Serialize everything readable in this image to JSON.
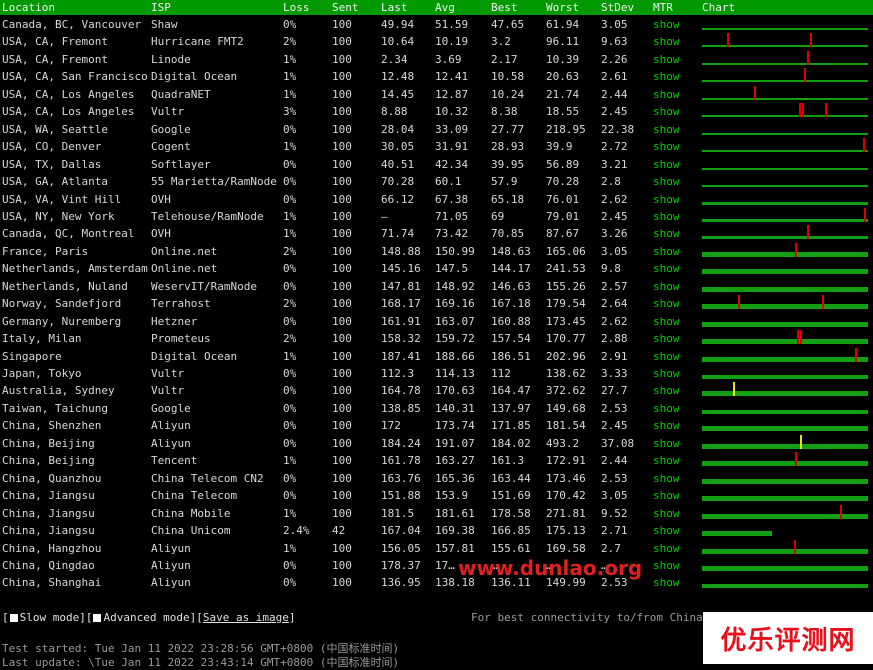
{
  "header": {
    "location": "Location",
    "isp": "ISP",
    "loss": "Loss",
    "sent": "Sent",
    "last": "Last",
    "avg": "Avg",
    "best": "Best",
    "worst": "Worst",
    "stdev": "StDev",
    "mtr": "MTR",
    "chart": "Chart"
  },
  "rows": [
    {
      "location": "Canada, BC, Vancouver",
      "isp": "Shaw",
      "loss": "0%",
      "sent": "100",
      "last": "49.94",
      "avg": "51.59",
      "best": "47.65",
      "worst": "61.94",
      "stdev": "3.05",
      "mtr": "show",
      "chart": {
        "fill": 0.25,
        "spikes": []
      }
    },
    {
      "location": "USA, CA, Fremont",
      "isp": "Hurricane FMT2",
      "loss": "2%",
      "sent": "100",
      "last": "10.64",
      "avg": "10.19",
      "best": "3.2",
      "worst": "96.11",
      "stdev": "9.63",
      "mtr": "show",
      "chart": {
        "fill": 0.25,
        "spikes": [
          {
            "pos": 0.15,
            "h": 0.9,
            "c": "red"
          },
          {
            "pos": 0.66,
            "h": 0.9,
            "c": "red"
          }
        ]
      }
    },
    {
      "location": "USA, CA, Fremont",
      "isp": "Linode",
      "loss": "1%",
      "sent": "100",
      "last": "2.34",
      "avg": "3.69",
      "best": "2.17",
      "worst": "10.39",
      "stdev": "2.26",
      "mtr": "show",
      "chart": {
        "fill": 0.1,
        "spikes": [
          {
            "pos": 0.64,
            "h": 0.9,
            "c": "red"
          }
        ]
      }
    },
    {
      "location": "USA, CA, San Francisco",
      "isp": "Digital Ocean",
      "loss": "1%",
      "sent": "100",
      "last": "12.48",
      "avg": "12.41",
      "best": "10.58",
      "worst": "20.63",
      "stdev": "2.61",
      "mtr": "show",
      "chart": {
        "fill": 0.15,
        "spikes": [
          {
            "pos": 0.62,
            "h": 0.9,
            "c": "red"
          }
        ]
      }
    },
    {
      "location": "USA, CA, Los Angeles",
      "isp": "QuadraNET",
      "loss": "1%",
      "sent": "100",
      "last": "14.45",
      "avg": "12.87",
      "best": "10.24",
      "worst": "21.74",
      "stdev": "2.44",
      "mtr": "show",
      "chart": {
        "fill": 0.15,
        "spikes": [
          {
            "pos": 0.32,
            "h": 0.9,
            "c": "red"
          }
        ]
      }
    },
    {
      "location": "USA, CA, Los Angeles",
      "isp": "Vultr",
      "loss": "3%",
      "sent": "100",
      "last": "8.88",
      "avg": "10.32",
      "best": "8.38",
      "worst": "18.55",
      "stdev": "2.45",
      "mtr": "show",
      "chart": {
        "fill": 0.15,
        "spikes": [
          {
            "pos": 0.59,
            "h": 0.9,
            "c": "red"
          },
          {
            "pos": 0.61,
            "h": 0.9,
            "c": "red"
          },
          {
            "pos": 0.75,
            "h": 0.9,
            "c": "red"
          }
        ]
      }
    },
    {
      "location": "USA, WA, Seattle",
      "isp": "Google",
      "loss": "0%",
      "sent": "100",
      "last": "28.04",
      "avg": "33.09",
      "best": "27.77",
      "worst": "218.95",
      "stdev": "22.38",
      "mtr": "show",
      "chart": {
        "fill": 0.2,
        "spikes": []
      }
    },
    {
      "location": "USA, CO, Denver",
      "isp": "Cogent",
      "loss": "1%",
      "sent": "100",
      "last": "30.05",
      "avg": "31.91",
      "best": "28.93",
      "worst": "39.9",
      "stdev": "2.72",
      "mtr": "show",
      "chart": {
        "fill": 0.2,
        "spikes": [
          {
            "pos": 0.98,
            "h": 0.9,
            "c": "red"
          }
        ]
      }
    },
    {
      "location": "USA, TX, Dallas",
      "isp": "Softlayer",
      "loss": "0%",
      "sent": "100",
      "last": "40.51",
      "avg": "42.34",
      "best": "39.95",
      "worst": "56.89",
      "stdev": "3.21",
      "mtr": "show",
      "chart": {
        "fill": 0.25,
        "spikes": []
      }
    },
    {
      "location": "USA, GA, Atlanta",
      "isp": "55 Marietta/RamNode",
      "loss": "0%",
      "sent": "100",
      "last": "70.28",
      "avg": "60.1",
      "best": "57.9",
      "worst": "70.28",
      "stdev": "2.8",
      "mtr": "show",
      "chart": {
        "fill": 0.3,
        "spikes": []
      }
    },
    {
      "location": "USA, VA, Vint Hill",
      "isp": "OVH",
      "loss": "0%",
      "sent": "100",
      "last": "66.12",
      "avg": "67.38",
      "best": "65.18",
      "worst": "76.01",
      "stdev": "2.62",
      "mtr": "show",
      "chart": {
        "fill": 0.35,
        "spikes": []
      }
    },
    {
      "location": "USA, NY, New York",
      "isp": "Telehouse/RamNode",
      "loss": "1%",
      "sent": "100",
      "last": "–",
      "avg": "71.05",
      "best": "69",
      "worst": "79.01",
      "stdev": "2.45",
      "mtr": "show",
      "chart": {
        "fill": 0.35,
        "spikes": [
          {
            "pos": 0.99,
            "h": 0.9,
            "c": "red"
          }
        ]
      }
    },
    {
      "location": "Canada, QC, Montreal",
      "isp": "OVH",
      "loss": "1%",
      "sent": "100",
      "last": "71.74",
      "avg": "73.42",
      "best": "70.85",
      "worst": "87.67",
      "stdev": "3.26",
      "mtr": "show",
      "chart": {
        "fill": 0.35,
        "spikes": [
          {
            "pos": 0.64,
            "h": 0.9,
            "c": "red"
          }
        ]
      }
    },
    {
      "location": "France, Paris",
      "isp": "Online.net",
      "loss": "2%",
      "sent": "100",
      "last": "148.88",
      "avg": "150.99",
      "best": "148.63",
      "worst": "165.06",
      "stdev": "3.05",
      "mtr": "show",
      "chart": {
        "fill": 0.6,
        "spikes": [
          {
            "pos": 0.57,
            "h": 0.9,
            "c": "red"
          }
        ]
      }
    },
    {
      "location": "Netherlands, Amsterdam",
      "isp": "Online.net",
      "loss": "0%",
      "sent": "100",
      "last": "145.16",
      "avg": "147.5",
      "best": "144.17",
      "worst": "241.53",
      "stdev": "9.8",
      "mtr": "show",
      "chart": {
        "fill": 0.6,
        "spikes": []
      }
    },
    {
      "location": "Netherlands, Nuland",
      "isp": "WeservIT/RamNode",
      "loss": "0%",
      "sent": "100",
      "last": "147.81",
      "avg": "148.92",
      "best": "146.63",
      "worst": "155.26",
      "stdev": "2.57",
      "mtr": "show",
      "chart": {
        "fill": 0.6,
        "spikes": []
      }
    },
    {
      "location": "Norway, Sandefjord",
      "isp": "Terrahost",
      "loss": "2%",
      "sent": "100",
      "last": "168.17",
      "avg": "169.16",
      "best": "167.18",
      "worst": "179.54",
      "stdev": "2.64",
      "mtr": "show",
      "chart": {
        "fill": 0.6,
        "spikes": [
          {
            "pos": 0.22,
            "h": 0.9,
            "c": "red"
          },
          {
            "pos": 0.73,
            "h": 0.9,
            "c": "red"
          }
        ]
      }
    },
    {
      "location": "Germany, Nuremberg",
      "isp": "Hetzner",
      "loss": "0%",
      "sent": "100",
      "last": "161.91",
      "avg": "163.07",
      "best": "160.88",
      "worst": "173.45",
      "stdev": "2.62",
      "mtr": "show",
      "chart": {
        "fill": 0.6,
        "spikes": []
      }
    },
    {
      "location": "Italy, Milan",
      "isp": "Prometeus",
      "loss": "2%",
      "sent": "100",
      "last": "158.32",
      "avg": "159.72",
      "best": "157.54",
      "worst": "170.77",
      "stdev": "2.88",
      "mtr": "show",
      "chart": {
        "fill": 0.6,
        "spikes": [
          {
            "pos": 0.58,
            "h": 0.9,
            "c": "red"
          },
          {
            "pos": 0.6,
            "h": 0.9,
            "c": "red"
          }
        ]
      }
    },
    {
      "location": "Singapore",
      "isp": "Digital Ocean",
      "loss": "1%",
      "sent": "100",
      "last": "187.41",
      "avg": "188.66",
      "best": "186.51",
      "worst": "202.96",
      "stdev": "2.91",
      "mtr": "show",
      "chart": {
        "fill": 0.6,
        "spikes": [
          {
            "pos": 0.93,
            "h": 0.9,
            "c": "red"
          }
        ]
      }
    },
    {
      "location": "Japan, Tokyo",
      "isp": "Vultr",
      "loss": "0%",
      "sent": "100",
      "last": "112.3",
      "avg": "114.13",
      "best": "112",
      "worst": "138.62",
      "stdev": "3.33",
      "mtr": "show",
      "chart": {
        "fill": 0.5,
        "spikes": []
      }
    },
    {
      "location": "Australia, Sydney",
      "isp": "Vultr",
      "loss": "0%",
      "sent": "100",
      "last": "164.78",
      "avg": "170.63",
      "best": "164.47",
      "worst": "372.62",
      "stdev": "27.7",
      "mtr": "show",
      "chart": {
        "fill": 0.6,
        "spikes": [
          {
            "pos": 0.19,
            "h": 0.9,
            "c": "yellow"
          }
        ]
      }
    },
    {
      "location": "Taiwan, Taichung",
      "isp": "Google",
      "loss": "0%",
      "sent": "100",
      "last": "138.85",
      "avg": "140.31",
      "best": "137.97",
      "worst": "149.68",
      "stdev": "2.53",
      "mtr": "show",
      "chart": {
        "fill": 0.55,
        "spikes": []
      }
    },
    {
      "location": "China, Shenzhen",
      "isp": "Aliyun",
      "loss": "0%",
      "sent": "100",
      "last": "172",
      "avg": "173.74",
      "best": "171.85",
      "worst": "181.54",
      "stdev": "2.45",
      "mtr": "show",
      "chart": {
        "fill": 0.6,
        "spikes": []
      }
    },
    {
      "location": "China, Beijing",
      "isp": "Aliyun",
      "loss": "0%",
      "sent": "100",
      "last": "184.24",
      "avg": "191.07",
      "best": "184.02",
      "worst": "493.2",
      "stdev": "37.08",
      "mtr": "show",
      "chart": {
        "fill": 0.6,
        "spikes": [
          {
            "pos": 0.6,
            "h": 0.9,
            "c": "yellow"
          }
        ]
      }
    },
    {
      "location": "China, Beijing",
      "isp": "Tencent",
      "loss": "1%",
      "sent": "100",
      "last": "161.78",
      "avg": "163.27",
      "best": "161.3",
      "worst": "172.91",
      "stdev": "2.44",
      "mtr": "show",
      "chart": {
        "fill": 0.6,
        "spikes": [
          {
            "pos": 0.57,
            "h": 0.9,
            "c": "red"
          }
        ]
      }
    },
    {
      "location": "China, Quanzhou",
      "isp": "China Telecom CN2",
      "loss": "0%",
      "sent": "100",
      "last": "163.76",
      "avg": "165.36",
      "best": "163.44",
      "worst": "173.46",
      "stdev": "2.53",
      "mtr": "show",
      "chart": {
        "fill": 0.6,
        "spikes": []
      }
    },
    {
      "location": "China, Jiangsu",
      "isp": "China Telecom",
      "loss": "0%",
      "sent": "100",
      "last": "151.88",
      "avg": "153.9",
      "best": "151.69",
      "worst": "170.42",
      "stdev": "3.05",
      "mtr": "show",
      "chart": {
        "fill": 0.6,
        "spikes": []
      }
    },
    {
      "location": "China, Jiangsu",
      "isp": "China Mobile",
      "loss": "1%",
      "sent": "100",
      "last": "181.5",
      "avg": "181.61",
      "best": "178.58",
      "worst": "271.81",
      "stdev": "9.52",
      "mtr": "show",
      "chart": {
        "fill": 0.6,
        "spikes": [
          {
            "pos": 0.84,
            "h": 0.9,
            "c": "red"
          }
        ]
      }
    },
    {
      "location": "China, Jiangsu",
      "isp": "China Unicom",
      "loss": "2.4%",
      "sent": "42",
      "last": "167.04",
      "avg": "169.38",
      "best": "166.85",
      "worst": "175.13",
      "stdev": "2.71",
      "mtr": "show",
      "chart": {
        "fill": 0.6,
        "width": 0.42,
        "spikes": []
      }
    },
    {
      "location": "China, Hangzhou",
      "isp": "Aliyun",
      "loss": "1%",
      "sent": "100",
      "last": "156.05",
      "avg": "157.81",
      "best": "155.61",
      "worst": "169.58",
      "stdev": "2.7",
      "mtr": "show",
      "chart": {
        "fill": 0.6,
        "spikes": [
          {
            "pos": 0.56,
            "h": 0.9,
            "c": "red"
          }
        ]
      }
    },
    {
      "location": "China, Qingdao",
      "isp": "Aliyun",
      "loss": "0%",
      "sent": "100",
      "last": "178.37",
      "avg": "17…",
      "best": "…",
      "worst": "…",
      "stdev": "…",
      "mtr": "show",
      "chart": {
        "fill": 0.6,
        "spikes": []
      }
    },
    {
      "location": "China, Shanghai",
      "isp": "Aliyun",
      "loss": "0%",
      "sent": "100",
      "last": "136.95",
      "avg": "138.18",
      "best": "136.11",
      "worst": "149.99",
      "stdev": "2.53",
      "mtr": "show",
      "chart": {
        "fill": 0.55,
        "spikes": []
      }
    }
  ],
  "options": {
    "slow_mode": "Slow mode",
    "advanced_mode": "Advanced mode",
    "save_as_image": "Save as image",
    "best_connectivity": "For best connectivity to/from China"
  },
  "footer": {
    "started": "Test started: Tue Jan 11 2022 23:28:56 GMT+0800 (中国标准时间)",
    "updated": "Last update: \\Tue Jan 11 2022 23:43:14 GMT+0800 (中国标准时间)"
  },
  "watermark": "www.dunlao.org",
  "logo": "优乐评测网",
  "colors": {
    "header_bg": "#009900",
    "bar": "#12a012",
    "spike_red": "#e00000",
    "spike_yellow": "#e6e600"
  }
}
